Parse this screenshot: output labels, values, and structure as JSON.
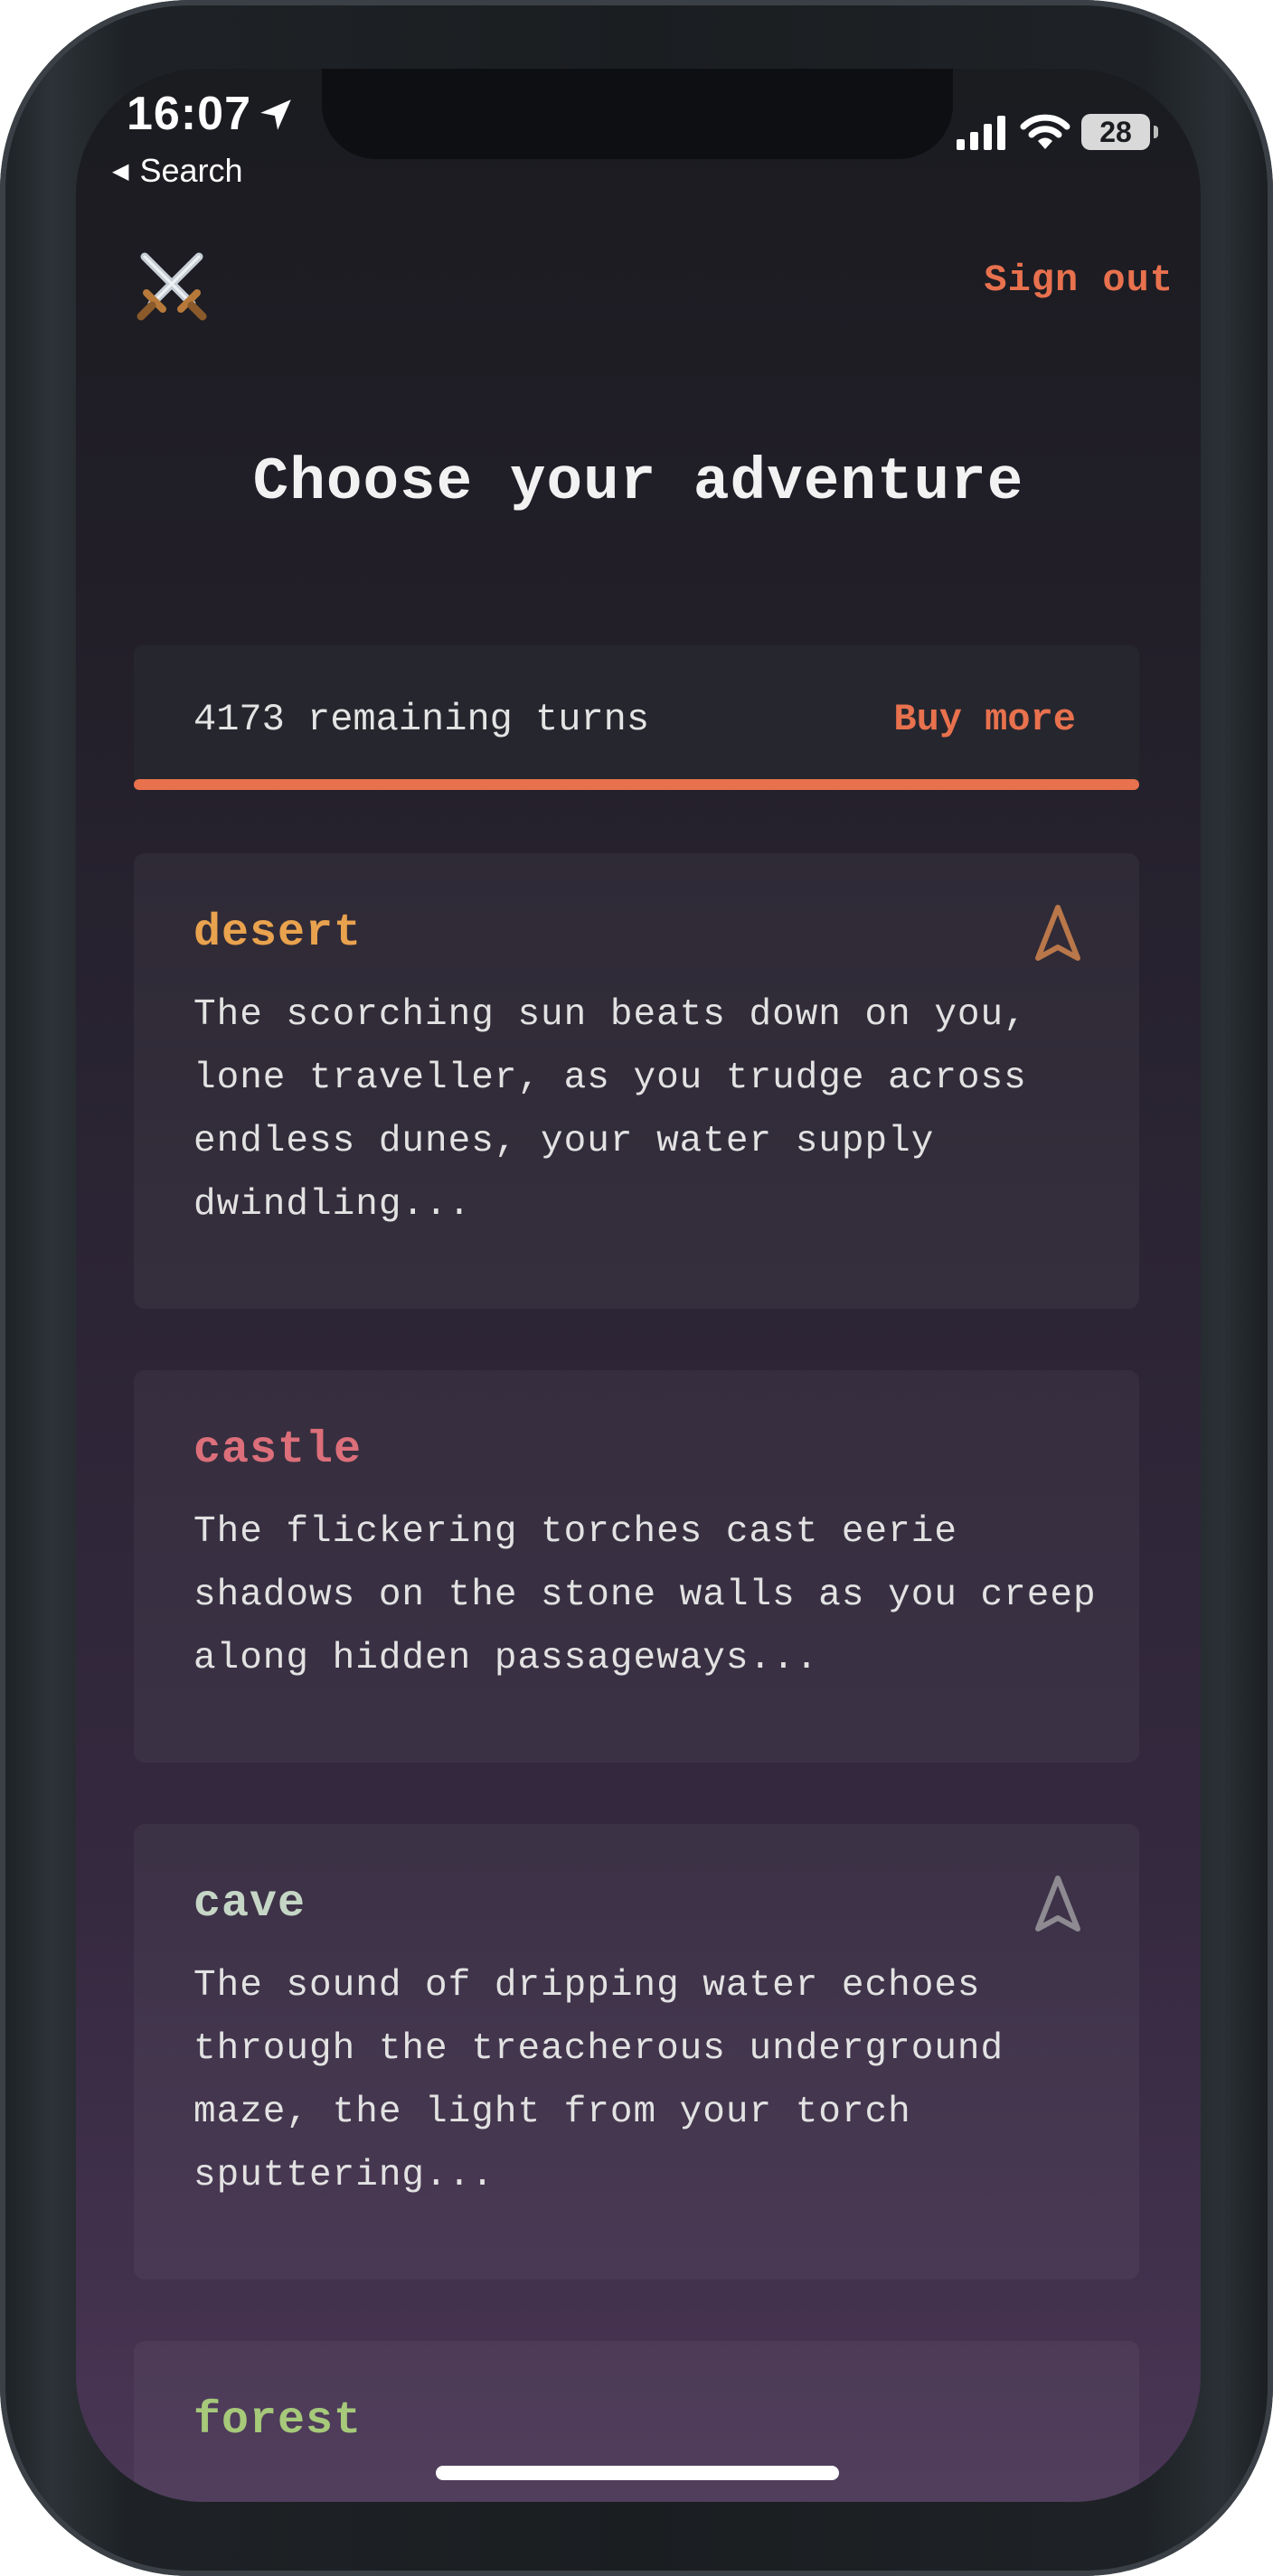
{
  "status_bar": {
    "time": "16:07",
    "back_label": "Search",
    "battery": "28"
  },
  "header": {
    "logo_icon": "crossed-swords-icon",
    "sign_out_label": "Sign out"
  },
  "page": {
    "title": "Choose your adventure"
  },
  "turns": {
    "text": "4173 remaining turns",
    "buy_label": "Buy more",
    "progress": 1.0,
    "accent_color": "#e8714e"
  },
  "adventures": [
    {
      "title": "desert",
      "color": "#e9a24e",
      "description": "The scorching sun beats down on you, lone traveller, as you trudge across endless dunes, your water supply dwindling...",
      "icon": "navigation-arrow-icon"
    },
    {
      "title": "castle",
      "color": "#dc6f7a",
      "description": "The flickering torches cast eerie shadows on the stone walls as you creep along hidden passageways..."
    },
    {
      "title": "cave",
      "color": "#c6d6c6",
      "description": "The sound of dripping water echoes through the treacherous underground maze, the light from your torch sputtering...",
      "icon": "navigation-arrow-icon"
    },
    {
      "title": "forest",
      "color": "#a6c97a"
    }
  ]
}
